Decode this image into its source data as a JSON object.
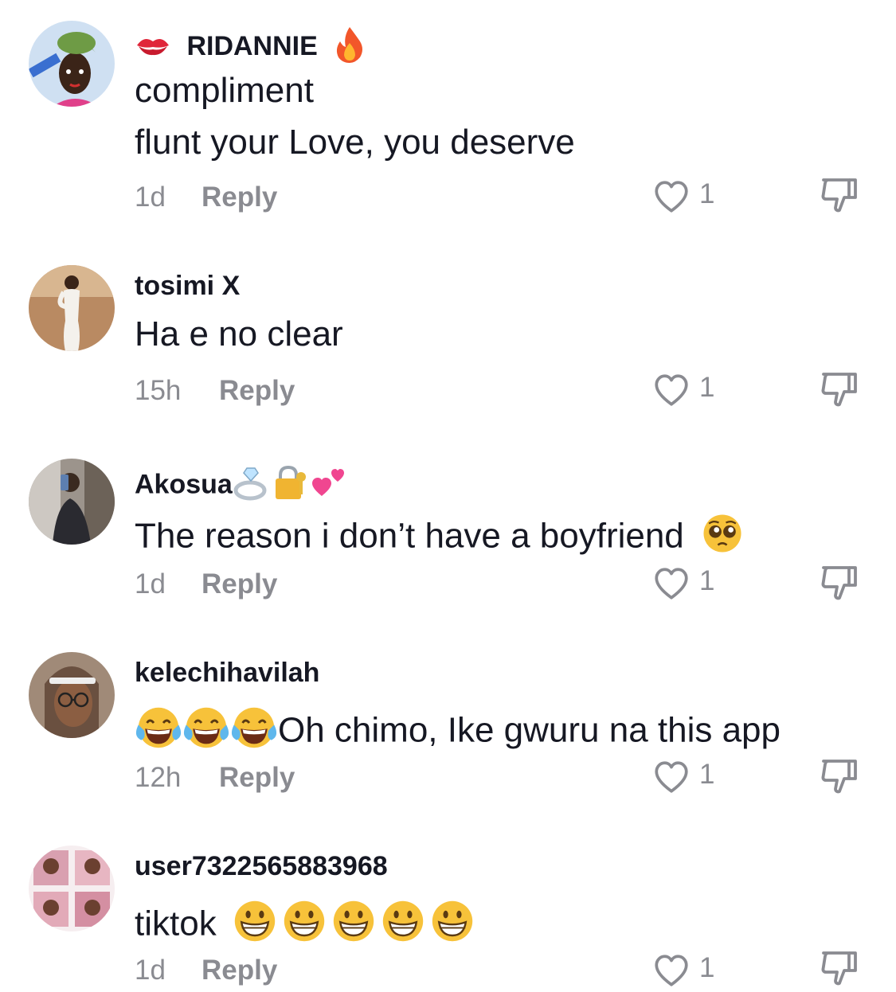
{
  "comments": [
    {
      "username": "RIDANNIE",
      "username_prefix_icon": "kiss-mark-emoji",
      "username_suffix_icon": "fire-emoji",
      "text": "compliment",
      "text2": "flunt your Love, you deserve",
      "time": "1d",
      "reply": "Reply",
      "likes": "1"
    },
    {
      "username": "tosimi X",
      "text": "Ha e no clear",
      "time": "15h",
      "reply": "Reply",
      "likes": "1"
    },
    {
      "username": "Akosua",
      "username_suffix_icons": [
        "ring-emoji",
        "locked-with-key-emoji",
        "two-hearts-emoji"
      ],
      "text": "The reason i don’t have a boyfriend",
      "text_suffix_icon": "pleading-face-emoji",
      "time": "1d",
      "reply": "Reply",
      "likes": "1"
    },
    {
      "username": "kelechihavilah",
      "text_prefix_icons": [
        "tears-of-joy-emoji",
        "tears-of-joy-emoji",
        "tears-of-joy-emoji"
      ],
      "text": "Oh chimo, Ike gwuru na this app",
      "time": "12h",
      "reply": "Reply",
      "likes": "1"
    },
    {
      "username": "user7322565883968",
      "text": "tiktok",
      "text_suffix_icons": [
        "grinning-face-emoji",
        "grinning-face-emoji",
        "grinning-face-emoji",
        "grinning-face-emoji",
        "grinning-face-emoji"
      ],
      "time": "1d",
      "reply": "Reply",
      "likes": "1"
    }
  ],
  "colors": {
    "primary_text": "#161823",
    "secondary_text": "#8a8b91",
    "background": "#ffffff"
  }
}
